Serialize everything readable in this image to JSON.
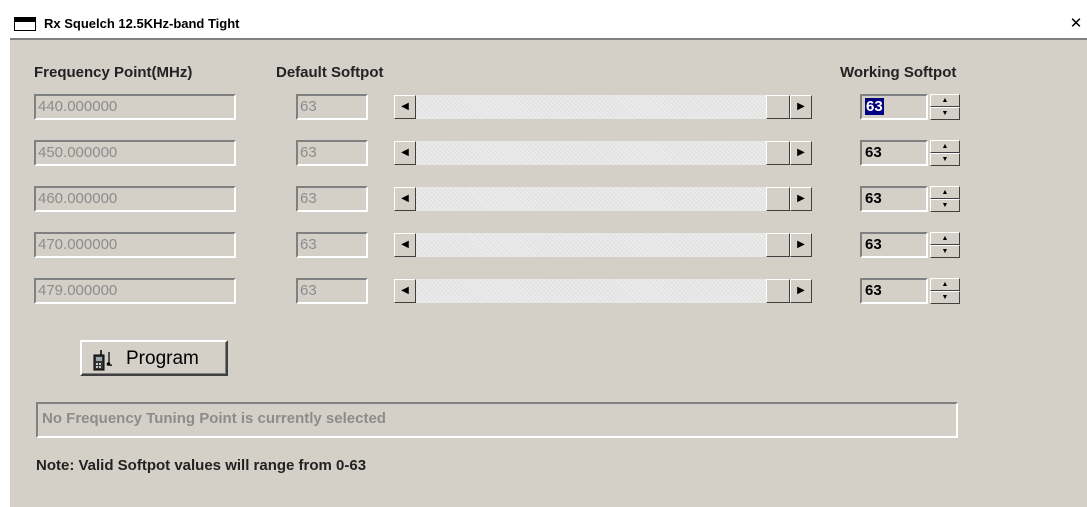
{
  "window": {
    "title": "Rx Squelch 12.5KHz-band Tight",
    "close_glyph": "✕"
  },
  "headers": {
    "frequency": "Frequency Point(MHz)",
    "default": "Default Softpot",
    "working": "Working Softpot"
  },
  "rows": [
    {
      "frequency": "440.000000",
      "default": "63",
      "working": "63",
      "slider_value": 63
    },
    {
      "frequency": "450.000000",
      "default": "63",
      "working": "63",
      "slider_value": 63
    },
    {
      "frequency": "460.000000",
      "default": "63",
      "working": "63",
      "slider_value": 63
    },
    {
      "frequency": "470.000000",
      "default": "63",
      "working": "63",
      "slider_value": 63
    },
    {
      "frequency": "479.000000",
      "default": "63",
      "working": "63",
      "slider_value": 63
    }
  ],
  "program_button": {
    "label": "Program",
    "icon": "radio-program-icon"
  },
  "status": "No Frequency Tuning Point is currently selected",
  "note": "Note: Valid Softpot values will range from 0-63",
  "slider": {
    "min": 0,
    "max": 63
  }
}
